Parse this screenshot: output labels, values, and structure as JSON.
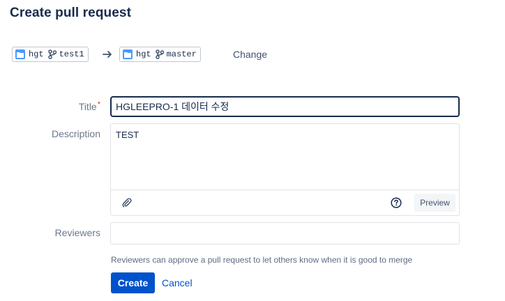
{
  "page": {
    "title": "Create pull request"
  },
  "source": {
    "repo": "hgt",
    "branch": "test1"
  },
  "destination": {
    "repo": "hgt",
    "branch": "master"
  },
  "change_label": "Change",
  "form": {
    "title_label": "Title",
    "title_required_mark": "*",
    "title_value": "HGLEEPRO-1 데이터 수정",
    "description_label": "Description",
    "description_value": "TEST",
    "preview_label": "Preview",
    "reviewers_label": "Reviewers",
    "reviewers_value": "",
    "reviewers_help": "Reviewers can approve a pull request to let others know when it is good to merge"
  },
  "actions": {
    "create_label": "Create",
    "cancel_label": "Cancel"
  },
  "icons": {
    "repo": "repo-icon",
    "branch": "branch-icon",
    "arrow": "arrow-right-icon",
    "attach": "paperclip-icon",
    "help": "help-icon"
  },
  "colors": {
    "primary": "#0052cc",
    "repo_icon": "#4c9aff",
    "required": "#de350b",
    "text": "#172b4d"
  }
}
